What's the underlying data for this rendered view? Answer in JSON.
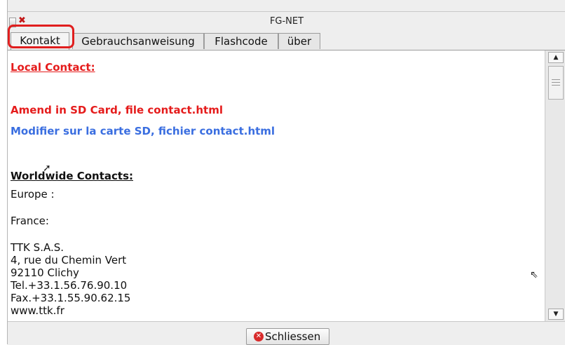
{
  "window": {
    "title": "FG-NET"
  },
  "tabs": [
    {
      "label": "Kontakt"
    },
    {
      "label": "Gebrauchsanweisung"
    },
    {
      "label": "Flashcode"
    },
    {
      "label": "über"
    }
  ],
  "content": {
    "local_heading": "Local Contact:",
    "amend_en": "Amend in SD Card, file contact.html",
    "amend_fr": "Modifier sur la carte SD, fichier contact.html",
    "worldwide_heading": "Worldwide Contacts:",
    "europe": "Europe :",
    "france": "France:",
    "address": [
      "TTK S.A.S.",
      "4, rue du Chemin Vert",
      "92110 Clichy",
      "Tel.+33.1.56.76.90.10",
      "Fax.+33.1.55.90.62.15",
      "www.ttk.fr"
    ]
  },
  "footer": {
    "close_label": "Schliessen"
  },
  "icons": {
    "close": "close-icon",
    "window_close": "window-close-icon"
  },
  "colors": {
    "highlight": "#e01e1e",
    "red_text": "#e51c1c",
    "blue_text": "#3a6ee0"
  }
}
